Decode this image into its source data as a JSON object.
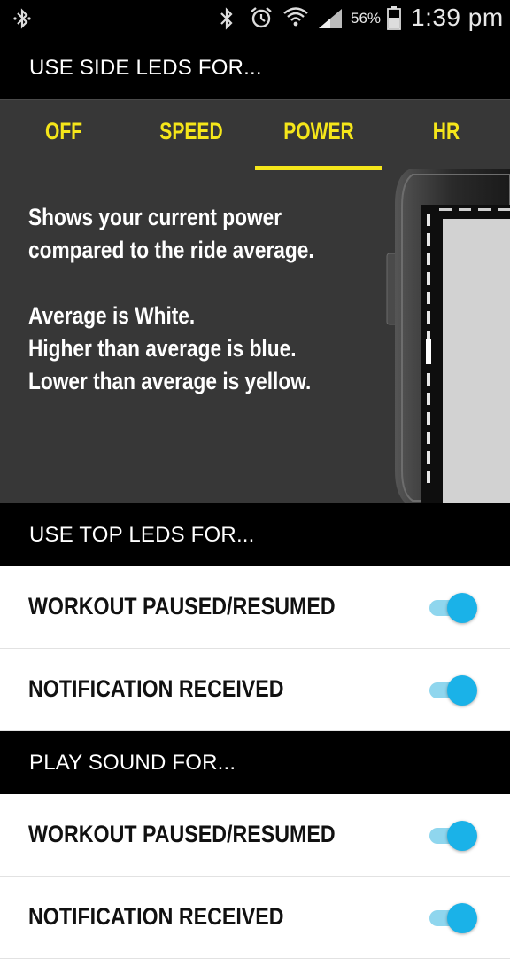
{
  "status_bar": {
    "battery_percent": "56%",
    "time": "1:39 pm",
    "icons": [
      "bluetooth-icon",
      "alarm-icon",
      "wifi-icon",
      "signal-icon",
      "battery-icon"
    ]
  },
  "side_leds": {
    "header": "USE SIDE LEDS FOR...",
    "tabs": [
      {
        "label": "OFF"
      },
      {
        "label": "SPEED"
      },
      {
        "label": "POWER",
        "selected": true
      },
      {
        "label": "HR"
      }
    ],
    "description": {
      "line1": "Shows your current power",
      "line2": "compared to the ride average.",
      "line3": "Average is White.",
      "line4": "Higher than average is blue.",
      "line5": "Lower than average is yellow."
    }
  },
  "top_leds": {
    "header": "USE TOP LEDS FOR...",
    "rows": [
      {
        "label": "WORKOUT PAUSED/RESUMED",
        "enabled": true
      },
      {
        "label": "NOTIFICATION RECEIVED",
        "enabled": true
      }
    ]
  },
  "play_sound": {
    "header": "PLAY SOUND FOR...",
    "rows": [
      {
        "label": "WORKOUT PAUSED/RESUMED",
        "enabled": true
      },
      {
        "label": "NOTIFICATION RECEIVED",
        "enabled": true
      }
    ]
  },
  "colors": {
    "accent_yellow": "#f5e61a",
    "toggle_on": "#1ab2e8",
    "toggle_track": "#8fd6ee",
    "panel_bg": "#373737"
  }
}
